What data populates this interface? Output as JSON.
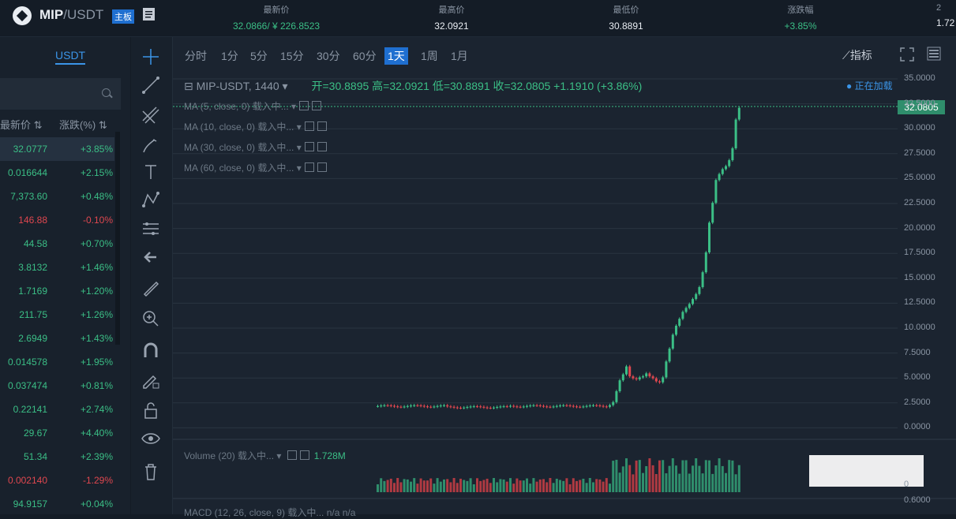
{
  "header": {
    "pair_base": "MIP",
    "pair_quote": "/USDT",
    "board_badge": "主板",
    "stats": [
      {
        "label": "最新价",
        "value": "32.0866/ ¥ 226.8523",
        "color": "green"
      },
      {
        "label": "最高价",
        "value": "32.0921",
        "color": "white"
      },
      {
        "label": "最低价",
        "value": "30.8891",
        "color": "white"
      },
      {
        "label": "涨跌幅",
        "value": "+3.85%",
        "color": "green"
      },
      {
        "label": "2",
        "value": "1.72",
        "color": "white"
      }
    ]
  },
  "sidebar": {
    "tab": "USDT",
    "col_price": "最新价",
    "col_change": "涨跌(%)",
    "rows": [
      {
        "price": "32.0777",
        "change": "+3.85%",
        "up": true
      },
      {
        "price": "0.016644",
        "change": "+2.15%",
        "up": true
      },
      {
        "price": "7,373.60",
        "change": "+0.48%",
        "up": true
      },
      {
        "price": "146.88",
        "change": "-0.10%",
        "up": false
      },
      {
        "price": "44.58",
        "change": "+0.70%",
        "up": true
      },
      {
        "price": "3.8132",
        "change": "+1.46%",
        "up": true
      },
      {
        "price": "1.7169",
        "change": "+1.20%",
        "up": true
      },
      {
        "price": "211.75",
        "change": "+1.26%",
        "up": true
      },
      {
        "price": "2.6949",
        "change": "+1.43%",
        "up": true
      },
      {
        "price": "0.014578",
        "change": "+1.95%",
        "up": true
      },
      {
        "price": "0.037474",
        "change": "+0.81%",
        "up": true
      },
      {
        "price": "0.22141",
        "change": "+2.74%",
        "up": true
      },
      {
        "price": "29.67",
        "change": "+4.40%",
        "up": true
      },
      {
        "price": "51.34",
        "change": "+2.39%",
        "up": true
      },
      {
        "price": "0.002140",
        "change": "-1.29%",
        "up": false
      },
      {
        "price": "94.9157",
        "change": "+0.04%",
        "up": true
      }
    ]
  },
  "toolbar": {
    "icons": [
      "crosshair-icon",
      "trend-line-icon",
      "fib-icon",
      "brush-icon",
      "text-icon",
      "pattern-icon",
      "measure-lines-icon",
      "back-arrow-icon",
      "ruler-icon",
      "zoom-in-icon",
      "magnet-icon",
      "lock-draw-icon",
      "unlock-icon",
      "eye-icon",
      "trash-icon"
    ]
  },
  "chart": {
    "timeframes": [
      "分时",
      "1分",
      "5分",
      "15分",
      "30分",
      "60分",
      "1天",
      "1周",
      "1月"
    ],
    "active_timeframe": "1天",
    "indicator_label": "指标",
    "symbol": "MIP-USDT, 1440",
    "ohlc": "开=30.8895  高=32.0921  低=30.8891  收=32.0805  +1.1910 (+3.86%)",
    "loading_text": "● 正在加载",
    "ma_lines": [
      "MA (5, close, 0) 载入中...",
      "MA (10, close, 0) 载入中...",
      "MA (30, close, 0) 载入中...",
      "MA (60, close, 0) 载入中..."
    ],
    "last_price_tag": "32.0805",
    "y_ticks": [
      "35.0000",
      "32.5000",
      "30.0000",
      "27.5000",
      "25.0000",
      "22.5000",
      "20.0000",
      "17.5000",
      "15.0000",
      "12.5000",
      "10.0000",
      "7.5000",
      "5.0000",
      "2.5000",
      "0.0000"
    ],
    "volume_legend": "Volume (20) 载入中...",
    "volume_value": "1.728M",
    "macd_legend": "MACD (12, 26, close, 9) 载入中...   n/a  n/a",
    "macd_tick": "0.6000",
    "vol_tick": "0"
  },
  "colors": {
    "up": "#3bbf86",
    "down": "#e0474f",
    "accent": "#1f6fd0"
  }
}
